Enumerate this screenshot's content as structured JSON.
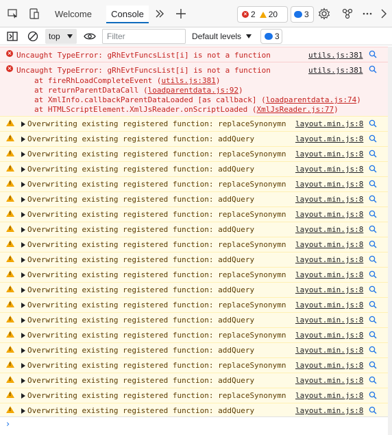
{
  "tabs": [
    {
      "label": "Welcome"
    },
    {
      "label": "Console"
    }
  ],
  "issue_counts": {
    "errors": "2",
    "warnings": "20",
    "messages": "3"
  },
  "toolbar": {
    "context": "top",
    "filter_placeholder": "Filter",
    "levels_label": "Default levels",
    "messages_count": "3"
  },
  "colors": {
    "accent": "#0f6cbd",
    "error": "#d93025",
    "warning": "#f2a600",
    "info": "#1a73e8"
  },
  "errors": [
    {
      "message": "Uncaught TypeError: gRhEvtFuncsList[i] is not a function",
      "source": "utils.js:381"
    },
    {
      "message": "Uncaught TypeError: gRhEvtFuncsList[i] is not a function",
      "source": "utils.js:381",
      "stack": [
        {
          "prefix": "at fireRhLoadCompleteEvent (",
          "link": "utils.js:381",
          "suffix": ")"
        },
        {
          "prefix": "at returnParentDataCall (",
          "link": "loadparentdata.js:92",
          "suffix": ")"
        },
        {
          "prefix": "at XmlInfo.callbackParentDataLoaded [as callback] (",
          "link": "loadparentdata.js:74",
          "suffix": ")"
        },
        {
          "prefix": "at HTMLScriptElement.XmlJsReader.onScriptLoaded (",
          "link": "XmlJsReader.js:77",
          "suffix": ")"
        }
      ]
    }
  ],
  "warnings": [
    {
      "message": "Overwriting existing registered function: replaceSynonymn",
      "source": "layout.min.js:8"
    },
    {
      "message": "Overwriting existing registered function: addQuery",
      "source": "layout.min.js:8"
    },
    {
      "message": "Overwriting existing registered function: replaceSynonymn",
      "source": "layout.min.js:8"
    },
    {
      "message": "Overwriting existing registered function: addQuery",
      "source": "layout.min.js:8"
    },
    {
      "message": "Overwriting existing registered function: replaceSynonymn",
      "source": "layout.min.js:8"
    },
    {
      "message": "Overwriting existing registered function: addQuery",
      "source": "layout.min.js:8"
    },
    {
      "message": "Overwriting existing registered function: replaceSynonymn",
      "source": "layout.min.js:8"
    },
    {
      "message": "Overwriting existing registered function: addQuery",
      "source": "layout.min.js:8"
    },
    {
      "message": "Overwriting existing registered function: replaceSynonymn",
      "source": "layout.min.js:8"
    },
    {
      "message": "Overwriting existing registered function: addQuery",
      "source": "layout.min.js:8"
    },
    {
      "message": "Overwriting existing registered function: replaceSynonymn",
      "source": "layout.min.js:8"
    },
    {
      "message": "Overwriting existing registered function: addQuery",
      "source": "layout.min.js:8"
    },
    {
      "message": "Overwriting existing registered function: replaceSynonymn",
      "source": "layout.min.js:8"
    },
    {
      "message": "Overwriting existing registered function: addQuery",
      "source": "layout.min.js:8"
    },
    {
      "message": "Overwriting existing registered function: replaceSynonymn",
      "source": "layout.min.js:8"
    },
    {
      "message": "Overwriting existing registered function: addQuery",
      "source": "layout.min.js:8"
    },
    {
      "message": "Overwriting existing registered function: replaceSynonymn",
      "source": "layout.min.js:8"
    },
    {
      "message": "Overwriting existing registered function: addQuery",
      "source": "layout.min.js:8"
    },
    {
      "message": "Overwriting existing registered function: replaceSynonymn",
      "source": "layout.min.js:8"
    },
    {
      "message": "Overwriting existing registered function: addQuery",
      "source": "layout.min.js:8"
    }
  ]
}
